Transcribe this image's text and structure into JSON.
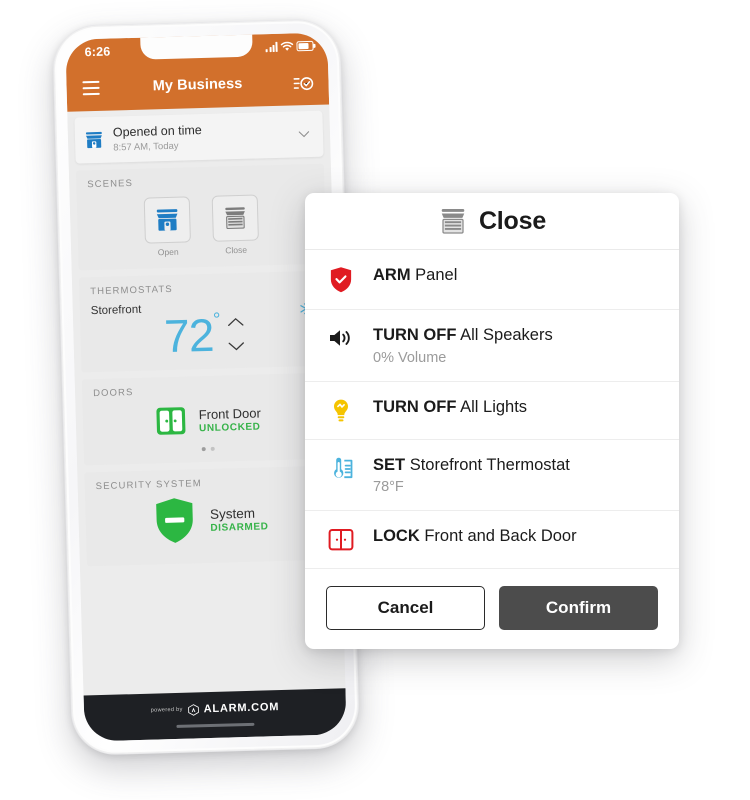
{
  "phone": {
    "statusbar": {
      "time": "6:26",
      "signal_icon": "signal-bars-icon",
      "wifi_icon": "wifi-icon",
      "battery_icon": "battery-icon"
    },
    "appbar": {
      "menu_icon": "hamburger-menu-icon",
      "title": "My Business",
      "history_icon": "activity-history-icon"
    },
    "banner": {
      "icon": "storefront-open-icon",
      "title": "Opened on time",
      "subtitle": "8:57 AM, Today",
      "chevron_icon": "chevron-down-icon"
    },
    "scenes": {
      "label": "SCENES",
      "items": [
        {
          "name": "Open",
          "icon": "storefront-open-icon",
          "color": "#1f7dc4"
        },
        {
          "name": "Close",
          "icon": "storefront-closed-icon",
          "color": "#7d7d7d"
        }
      ]
    },
    "thermostats": {
      "label": "THERMOSTATS",
      "name": "Storefront",
      "temperature": "72",
      "degree_symbol": "°",
      "mode_icon": "snowflake-icon",
      "mode_color": "#4cb3dd",
      "up_icon": "chevron-up-icon",
      "down_icon": "chevron-down-icon"
    },
    "doors": {
      "label": "DOORS",
      "icon": "door-lock-icon",
      "name": "Front Door",
      "status": "UNLOCKED",
      "status_color": "#37b34a",
      "page_dots": 2,
      "active_dot": 0
    },
    "security": {
      "label": "SECURITY SYSTEM",
      "icon": "shield-disarmed-icon",
      "name": "System",
      "status": "DISARMED",
      "status_color": "#37b34a"
    },
    "footer": {
      "powered_by": "powered by",
      "brand": "ALARM.COM",
      "home_indicator": "home-indicator"
    }
  },
  "modal": {
    "header": {
      "icon": "storefront-closed-icon",
      "title": "Close"
    },
    "rows": [
      {
        "icon": "shield-arm-icon",
        "color": "#e01b22",
        "action": "ARM",
        "target": "Panel",
        "sub": ""
      },
      {
        "icon": "speaker-icon",
        "color": "#1b1b1b",
        "action": "TURN OFF",
        "target": "All Speakers",
        "sub": "0% Volume"
      },
      {
        "icon": "lightbulb-icon",
        "color": "#f5c400",
        "action": "TURN OFF",
        "target": "All Lights",
        "sub": ""
      },
      {
        "icon": "thermostat-icon",
        "color": "#4cb3dd",
        "action": "SET",
        "target": "Storefront Thermostat",
        "sub": "78°F"
      },
      {
        "icon": "door-lock-icon",
        "color": "#e01b22",
        "action": "LOCK",
        "target": "Front and Back Door",
        "sub": ""
      }
    ],
    "buttons": {
      "cancel": "Cancel",
      "confirm": "Confirm"
    }
  }
}
